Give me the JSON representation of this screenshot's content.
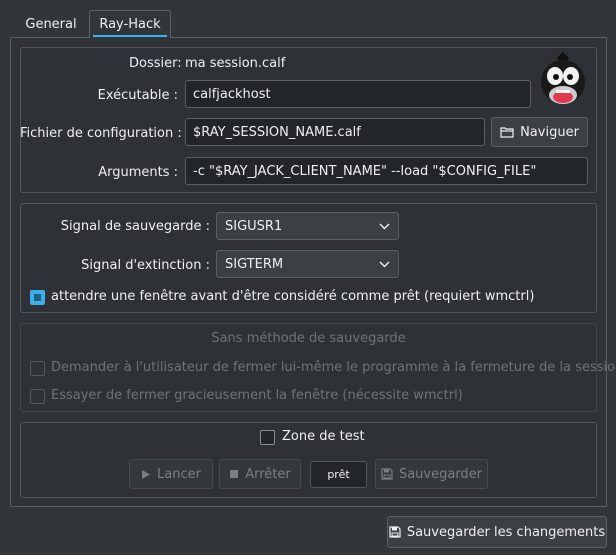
{
  "tabs": [
    {
      "label": "General"
    },
    {
      "label": "Ray-Hack"
    }
  ],
  "executable_group": {
    "folder_label": "Dossier:",
    "folder_value": "ma session.calf",
    "executable_label": "Exécutable :",
    "executable_value": "calfjackhost",
    "config_label": "Fichier de configuration :",
    "config_value": "$RAY_SESSION_NAME.calf",
    "browse_label": "Naviguer",
    "arguments_label": "Arguments :",
    "arguments_value": "-c \"$RAY_JACK_CLIENT_NAME\" --load \"$CONFIG_FILE\""
  },
  "signals_group": {
    "save_signal_label": "Signal de sauvegarde :",
    "save_signal_value": "SIGUSR1",
    "stop_signal_label": "Signal d'extinction :",
    "stop_signal_value": "SIGTERM",
    "wait_window_label": "attendre une fenêtre avant d'être considéré comme prêt (requiert wmctrl)",
    "wait_window_checked": true
  },
  "no_save_group": {
    "title": "Sans méthode de sauvegarde",
    "ask_user_label": "Demander à l'utilisateur de fermer lui-même le programme à la fermeture de la session",
    "close_gracefully_label": "Essayer de fermer gracieusement la fenêtre (nécessite wmctrl)"
  },
  "test_zone": {
    "label": "Zone de test",
    "checked": false,
    "start_label": "Lancer",
    "stop_label": "Arrêter",
    "state": "prêt",
    "save_label": "Sauvegarder"
  },
  "footer": {
    "save_changes_label": "Sauvegarder les changements"
  },
  "colors": {
    "background": "#31363b",
    "accent": "#3daee9",
    "field": "#232629",
    "text": "#eff0f1"
  }
}
